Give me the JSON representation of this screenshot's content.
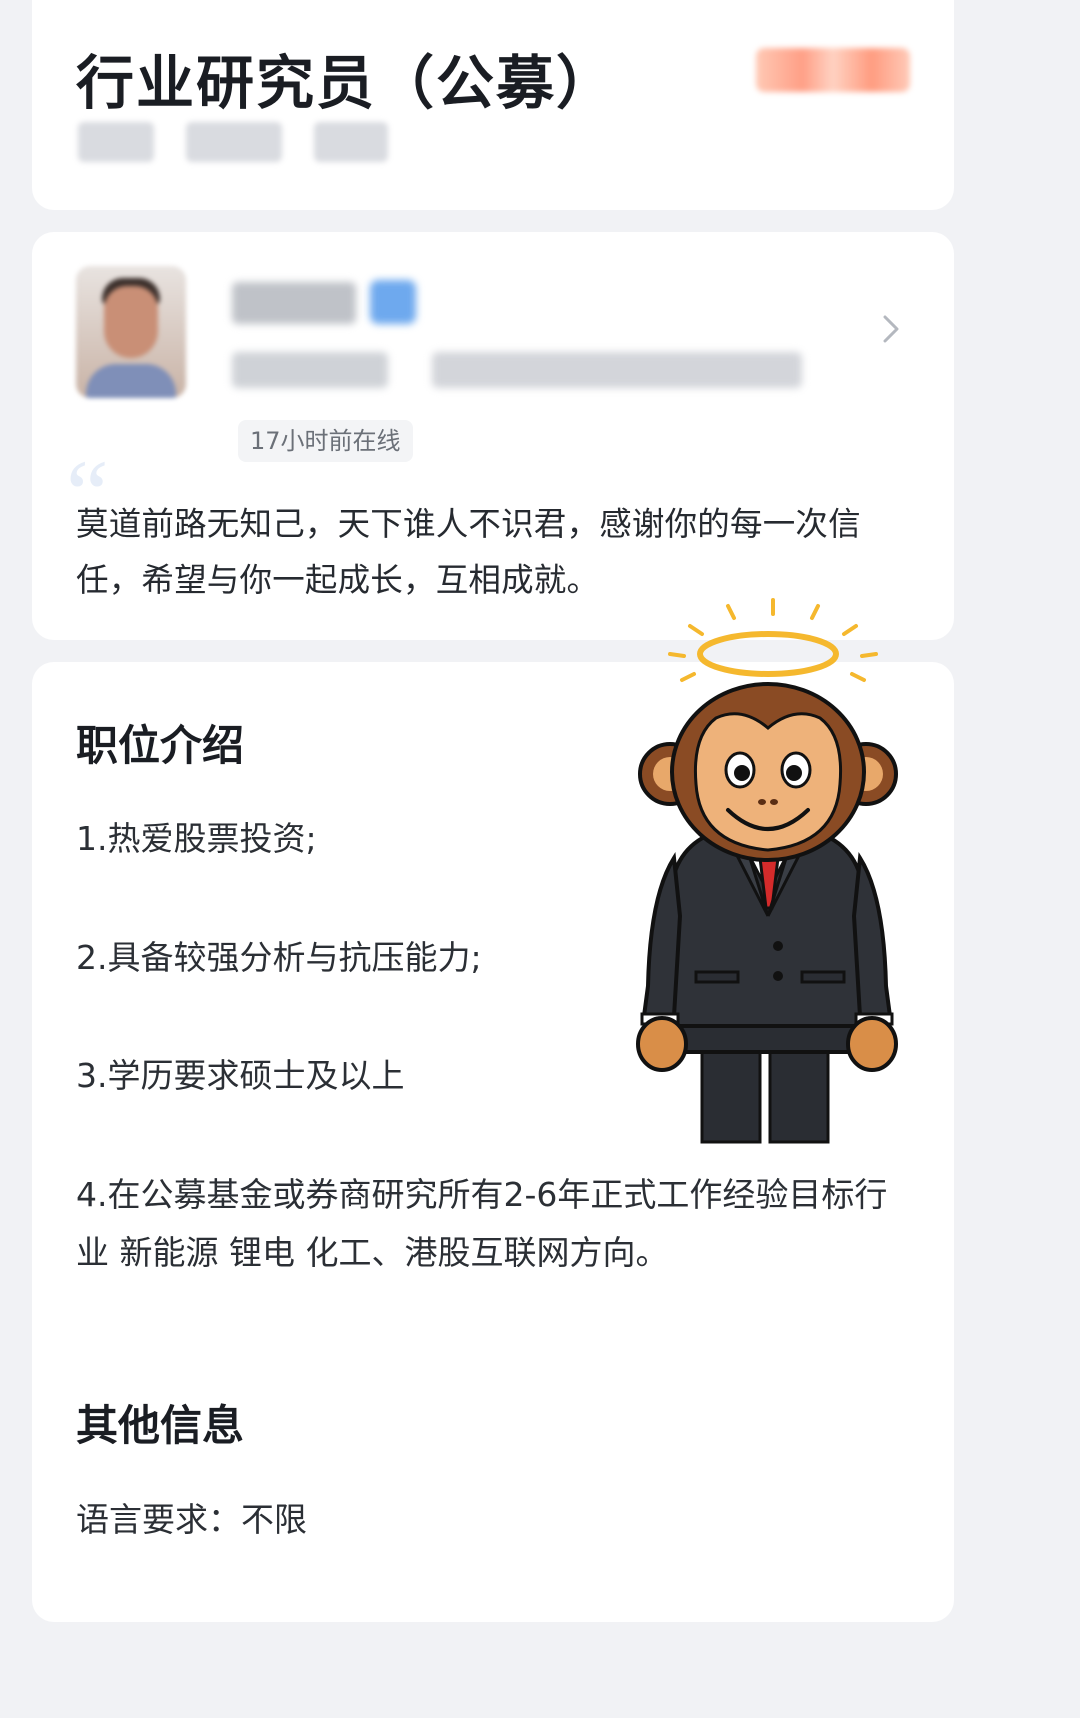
{
  "job": {
    "title": "行业研究员（公募）"
  },
  "recruiter": {
    "online_status": "17小时前在线",
    "motto": "莫道前路无知己，天下谁人不识君，感谢你的每一次信任，希望与你一起成长，互相成就。"
  },
  "description": {
    "title": "职位介绍",
    "requirements": [
      "1.热爱股票投资;",
      "2.具备较强分析与抗压能力;",
      "3.学历要求硕士及以上",
      "4.在公募基金或券商研究所有2-6年正式工作经验目标行业 新能源 锂电 化工、港股互联网方向。"
    ]
  },
  "other_info": {
    "title": "其他信息",
    "language": "语言要求：不限"
  },
  "icons": [
    "chevron-right-icon",
    "quote-icon",
    "monkey-sticker"
  ],
  "colors": {
    "background": "#f1f2f5",
    "card": "#ffffff",
    "text": "#1f2329",
    "muted": "#6b7078"
  }
}
